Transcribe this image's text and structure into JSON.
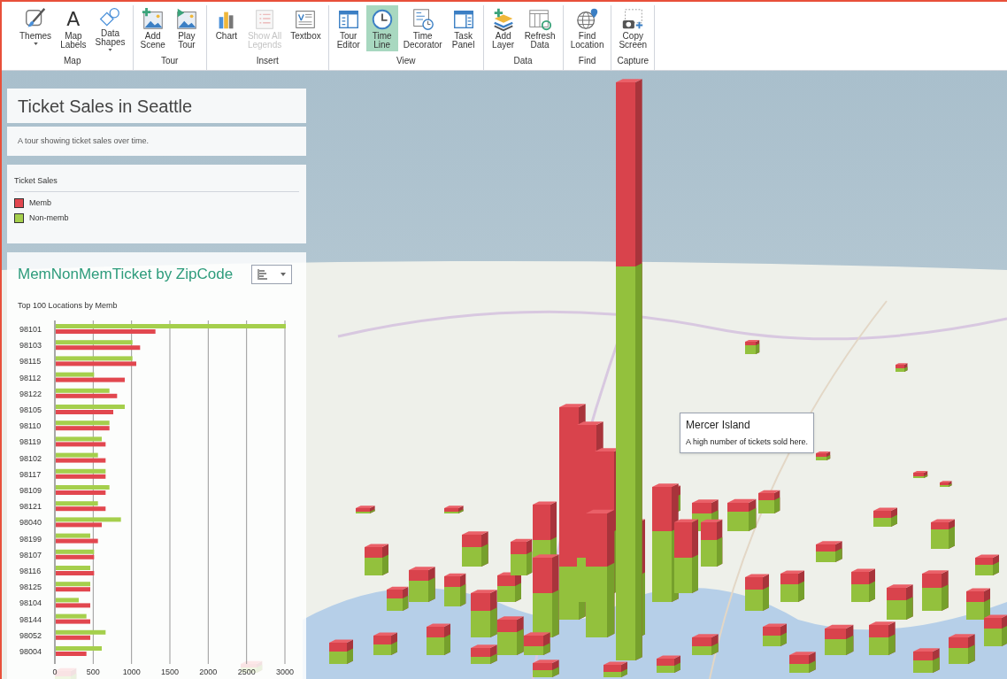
{
  "ribbon": {
    "groups": [
      {
        "label": "Map",
        "buttons": [
          {
            "label": "Themes",
            "selected": false,
            "disabled": false,
            "dropdown": true
          },
          {
            "label": "Map\nLabels",
            "icon_text": "A",
            "selected": false,
            "disabled": false,
            "dropdown": false
          },
          {
            "label": "Data\nShapes",
            "selected": false,
            "disabled": false,
            "dropdown": true
          }
        ]
      },
      {
        "label": "Tour",
        "buttons": [
          {
            "label": "Add\nScene",
            "selected": false,
            "disabled": false,
            "dropdown": false
          },
          {
            "label": "Play\nTour",
            "selected": false,
            "disabled": false,
            "dropdown": false
          }
        ]
      },
      {
        "label": "Insert",
        "buttons": [
          {
            "label": "Chart",
            "selected": false,
            "disabled": false,
            "dropdown": false
          },
          {
            "label": "Show All\nLegends",
            "selected": false,
            "disabled": true,
            "dropdown": false
          },
          {
            "label": "Textbox",
            "selected": false,
            "disabled": false,
            "dropdown": false
          }
        ]
      },
      {
        "label": "View",
        "buttons": [
          {
            "label": "Tour\nEditor",
            "selected": false,
            "disabled": false,
            "dropdown": false
          },
          {
            "label": "Time\nLine",
            "selected": true,
            "disabled": false,
            "dropdown": false
          },
          {
            "label": "Time\nDecorator",
            "selected": false,
            "disabled": false,
            "dropdown": false
          },
          {
            "label": "Task\nPanel",
            "selected": false,
            "disabled": false,
            "dropdown": false
          }
        ]
      },
      {
        "label": "Data",
        "buttons": [
          {
            "label": "Add\nLayer",
            "selected": false,
            "disabled": false,
            "dropdown": false
          },
          {
            "label": "Refresh\nData",
            "selected": false,
            "disabled": false,
            "dropdown": false
          }
        ]
      },
      {
        "label": "Find",
        "buttons": [
          {
            "label": "Find\nLocation",
            "selected": false,
            "disabled": false,
            "dropdown": false
          }
        ]
      },
      {
        "label": "Capture",
        "buttons": [
          {
            "label": "Copy\nScreen",
            "selected": false,
            "disabled": false,
            "dropdown": false
          }
        ]
      }
    ]
  },
  "tour": {
    "title": "Ticket Sales in Seattle",
    "description": "A tour showing ticket sales over time."
  },
  "legend": {
    "title": "Ticket Sales"
  },
  "chart_panel": {
    "title": "MemNonMemTicket by ZipCode",
    "subtitle": "Top 100 Locations by Memb",
    "chart_data": {
      "type": "bar",
      "orientation": "horizontal",
      "categories": [
        "98101",
        "98103",
        "98115",
        "98112",
        "98122",
        "98105",
        "98110",
        "98119",
        "98102",
        "98117",
        "98109",
        "98121",
        "98040",
        "98199",
        "98107",
        "98116",
        "98125",
        "98104",
        "98144",
        "98052",
        "98004"
      ],
      "series": [
        {
          "name": "Memb",
          "color": "#e2474f",
          "values": [
            1300,
            1100,
            1050,
            900,
            800,
            750,
            700,
            650,
            650,
            650,
            650,
            650,
            600,
            550,
            500,
            500,
            450,
            450,
            450,
            450,
            400
          ]
        },
        {
          "name": "Non-memb",
          "color": "#a5cf4c",
          "values": [
            3000,
            1000,
            1000,
            500,
            700,
            900,
            700,
            600,
            550,
            650,
            700,
            550,
            850,
            450,
            500,
            450,
            450,
            300,
            400,
            650,
            600
          ]
        }
      ],
      "xlim": [
        0,
        3000
      ],
      "xticks": [
        0,
        500,
        1000,
        1500,
        2000,
        2500,
        3000
      ],
      "grid": true
    }
  },
  "tooltip": {
    "title": "Mercer Island",
    "text": "A high number of tickets sold here."
  }
}
